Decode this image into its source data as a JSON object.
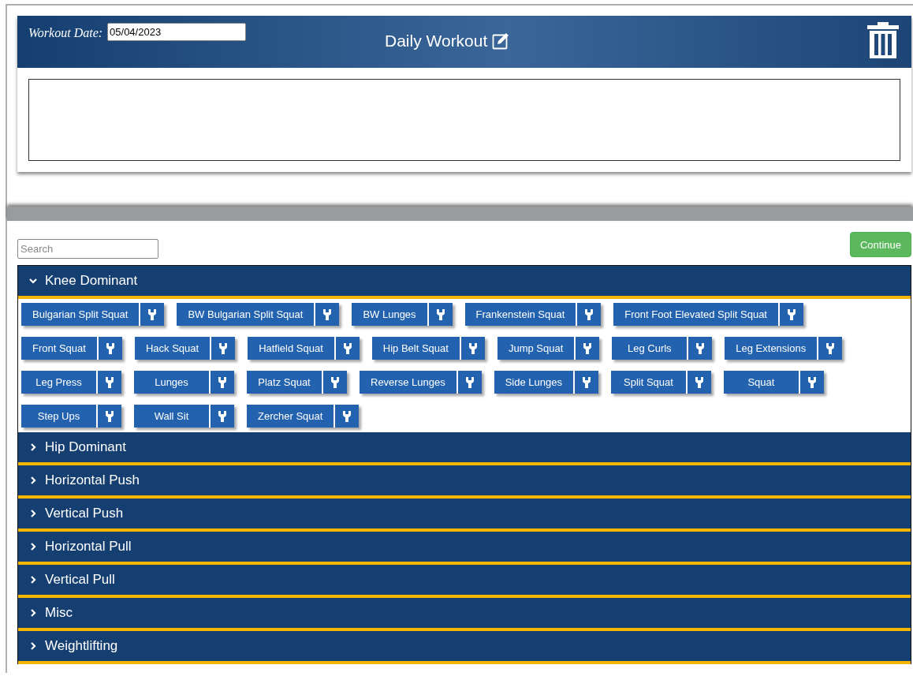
{
  "header": {
    "date_label": "Workout Date:",
    "date_value": "05/04/2023",
    "title": "Daily Workout"
  },
  "search": {
    "placeholder": "Search"
  },
  "continue_button": "Continue",
  "categories": [
    {
      "name": "Knee Dominant",
      "expanded": true,
      "exercises": [
        "Bulgarian Split Squat",
        "BW Bulgarian Split Squat",
        "BW Lunges",
        "Frankenstein Squat",
        "Front Foot Elevated Split Squat",
        "Front Squat",
        "Hack Squat",
        "Hatfield Squat",
        "Hip Belt Squat",
        "Jump Squat",
        "Leg Curls",
        "Leg Extensions",
        "Leg Press",
        "Lunges",
        "Platz Squat",
        "Reverse Lunges",
        "Side Lunges",
        "Split Squat",
        "Squat",
        "Step Ups",
        "Wall Sit",
        "Zercher Squat"
      ]
    },
    {
      "name": "Hip Dominant",
      "expanded": false
    },
    {
      "name": "Horizontal Push",
      "expanded": false
    },
    {
      "name": "Vertical Push",
      "expanded": false
    },
    {
      "name": "Horizontal Pull",
      "expanded": false
    },
    {
      "name": "Vertical Pull",
      "expanded": false
    },
    {
      "name": "Misc",
      "expanded": false
    },
    {
      "name": "Weightlifting",
      "expanded": false
    }
  ]
}
